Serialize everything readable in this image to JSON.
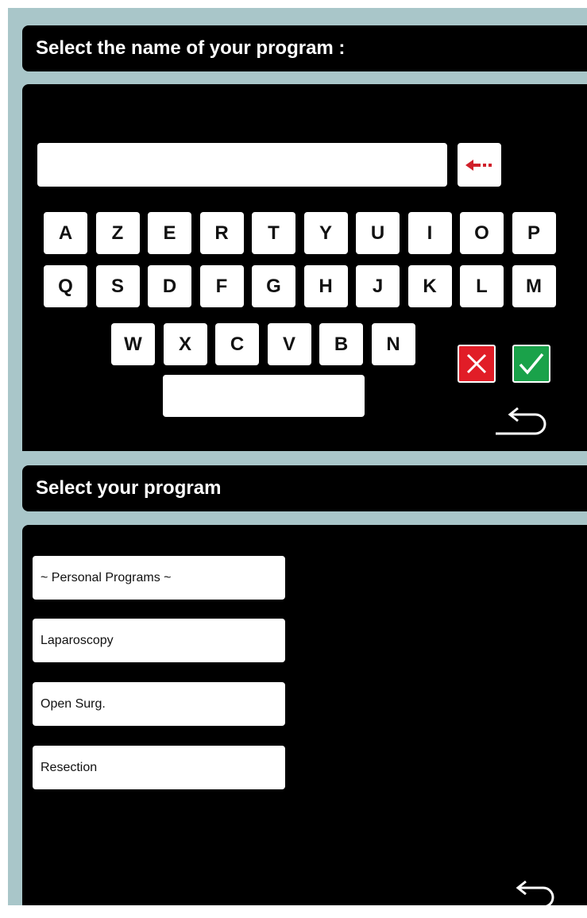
{
  "name_screen": {
    "title": "Select the name of your program :",
    "input_value": "",
    "keyboard_rows": [
      [
        "A",
        "Z",
        "E",
        "R",
        "T",
        "Y",
        "U",
        "I",
        "O",
        "P"
      ],
      [
        "Q",
        "S",
        "D",
        "F",
        "G",
        "H",
        "J",
        "K",
        "L",
        "M"
      ],
      [
        "W",
        "X",
        "C",
        "V",
        "B",
        "N"
      ]
    ],
    "icons": {
      "backspace": "dotted-left-arrow-icon",
      "cancel": "close-icon",
      "confirm": "checkmark-icon",
      "back": "return-arrow-icon"
    },
    "colors": {
      "backspace_arrow": "#d0202a",
      "cancel": "#e11d27",
      "confirm": "#1aa24a",
      "frame": "#a9c6c9"
    }
  },
  "program_screen": {
    "title": "Select your program",
    "programs": [
      "~ Personal Programs ~",
      "Laparoscopy",
      "Open Surg.",
      "Resection"
    ],
    "icons": {
      "back": "return-arrow-icon"
    }
  }
}
